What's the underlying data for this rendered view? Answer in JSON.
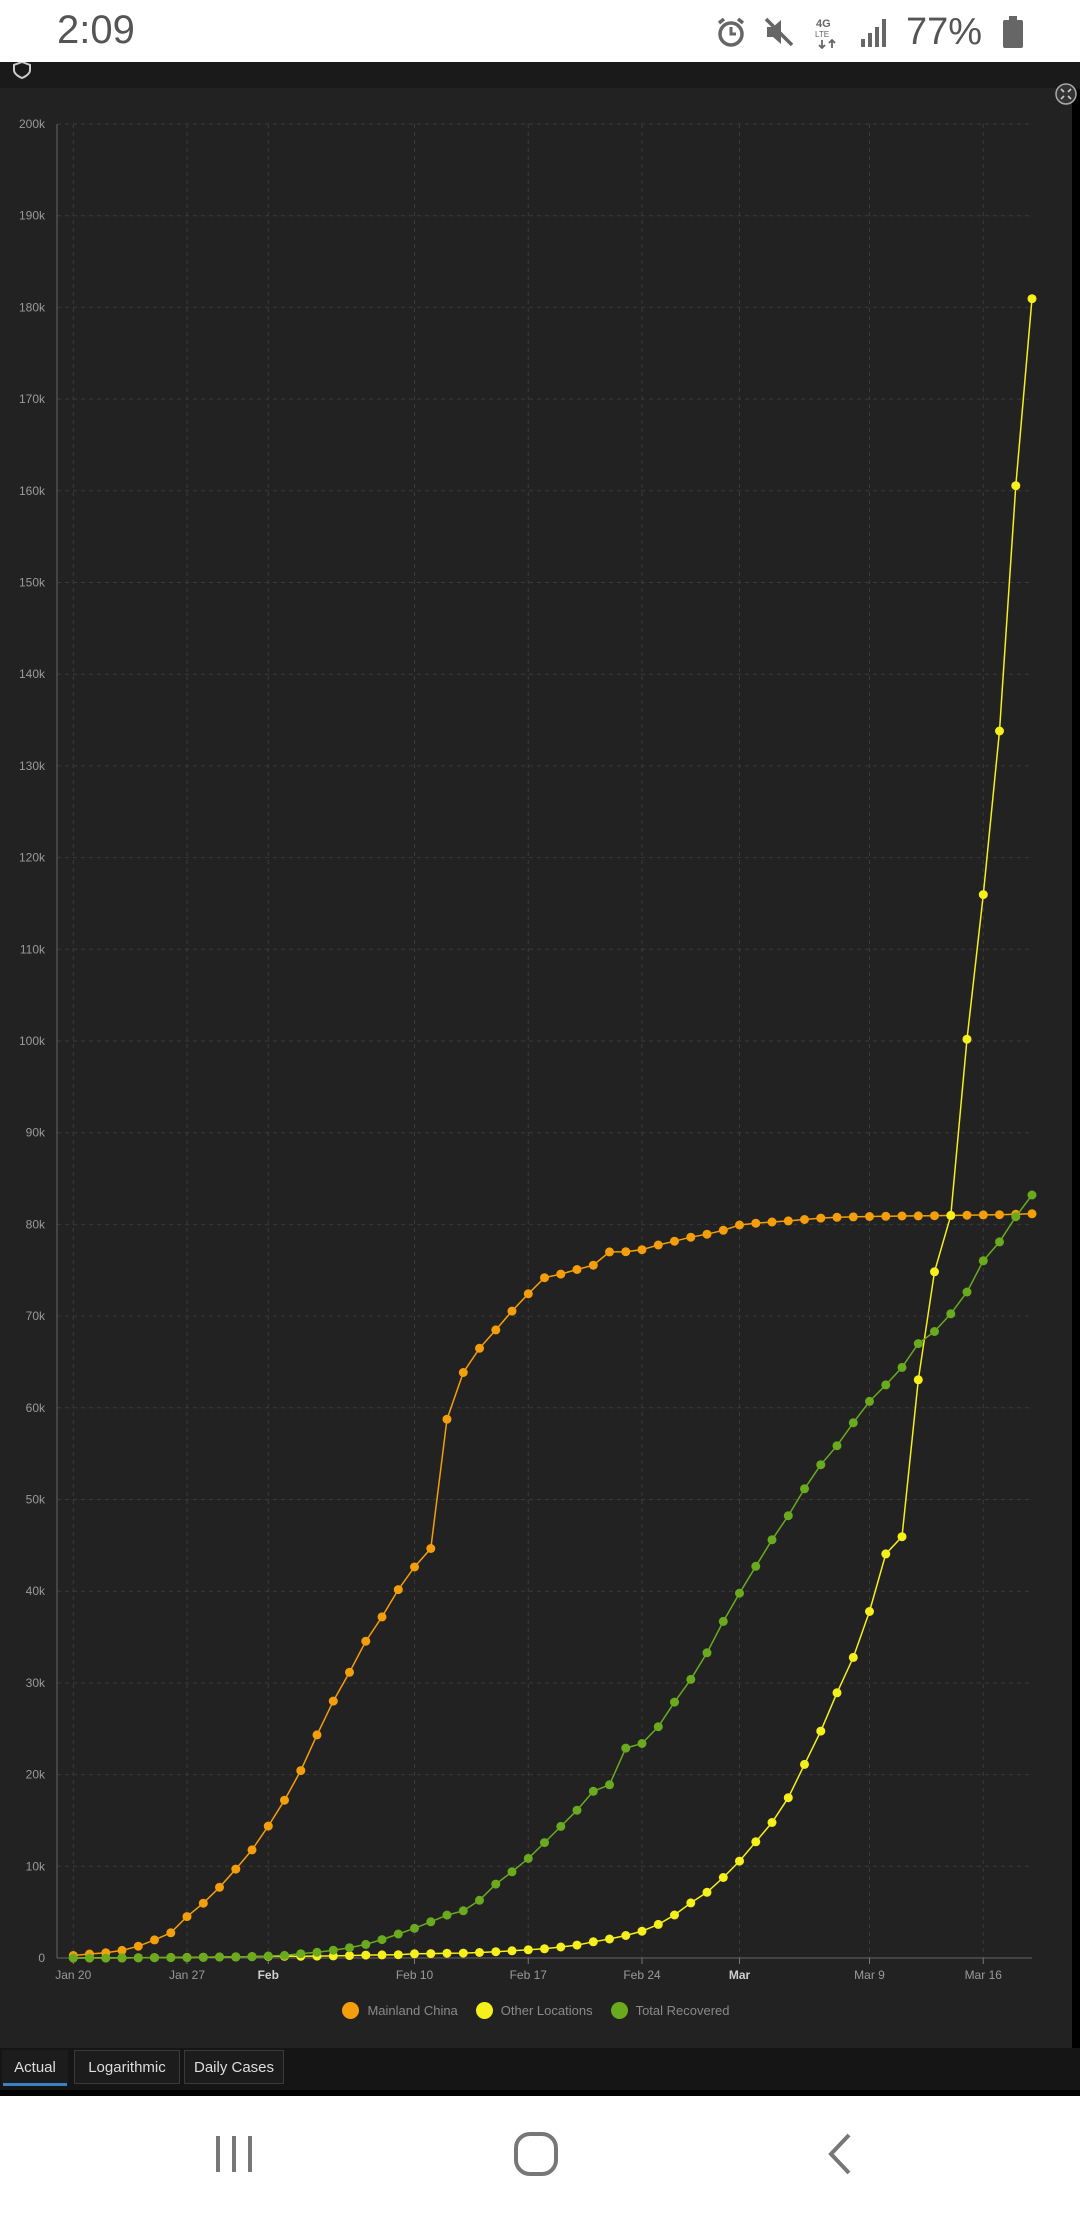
{
  "status_bar": {
    "time": "2:09",
    "battery_percent": "77%",
    "icons": [
      "alarm-icon",
      "mute-icon",
      "4g-lte-icon",
      "signal-icon",
      "battery-icon"
    ]
  },
  "tabs": [
    {
      "label": "Actual",
      "active": true
    },
    {
      "label": "Logarithmic",
      "active": false
    },
    {
      "label": "Daily Cases",
      "active": false
    }
  ],
  "nav_icons": [
    "recent-apps-icon",
    "home-icon",
    "back-icon"
  ],
  "chart_data": {
    "type": "line",
    "title": "",
    "xlabel": "",
    "ylabel": "",
    "ylim": [
      0,
      200000
    ],
    "yticks": [
      0,
      10000,
      20000,
      30000,
      40000,
      50000,
      60000,
      70000,
      80000,
      90000,
      100000,
      110000,
      120000,
      130000,
      140000,
      150000,
      160000,
      170000,
      180000,
      190000,
      200000
    ],
    "ytick_labels": [
      "0",
      "10k",
      "20k",
      "30k",
      "40k",
      "50k",
      "60k",
      "70k",
      "80k",
      "90k",
      "100k",
      "110k",
      "120k",
      "130k",
      "140k",
      "150k",
      "160k",
      "170k",
      "180k",
      "190k",
      "200k"
    ],
    "x_range": [
      "2020-01-19",
      "2020-03-19"
    ],
    "xticks": [
      {
        "date": "2020-01-20",
        "label": "Jan 20",
        "bold": false
      },
      {
        "date": "2020-01-27",
        "label": "Jan 27",
        "bold": false
      },
      {
        "date": "2020-02-01",
        "label": "Feb",
        "bold": true
      },
      {
        "date": "2020-02-10",
        "label": "Feb 10",
        "bold": false
      },
      {
        "date": "2020-02-17",
        "label": "Feb 17",
        "bold": false
      },
      {
        "date": "2020-02-24",
        "label": "Feb 24",
        "bold": false
      },
      {
        "date": "2020-03-01",
        "label": "Mar",
        "bold": true
      },
      {
        "date": "2020-03-09",
        "label": "Mar 9",
        "bold": false
      },
      {
        "date": "2020-03-16",
        "label": "Mar 16",
        "bold": false
      }
    ],
    "grid": true,
    "legend_position": "bottom-center",
    "start_date": "2020-01-20",
    "series": [
      {
        "name": "Mainland China",
        "color": "#f59e0b",
        "values": [
          278,
          440,
          571,
          830,
          1287,
          1975,
          2744,
          4515,
          5974,
          7711,
          9692,
          11791,
          14380,
          17205,
          20438,
          24324,
          28018,
          31161,
          34546,
          37198,
          40171,
          42638,
          44653,
          58761,
          63851,
          66492,
          68500,
          70548,
          72436,
          74185,
          74576,
          75077,
          75550,
          77001,
          77022,
          77241,
          77754,
          78166,
          78600,
          78928,
          79356,
          79932,
          80136,
          80261,
          80386,
          80537,
          80690,
          80770,
          80823,
          80860,
          80887,
          80921,
          80932,
          80945,
          80977,
          81003,
          81033,
          81058,
          81102,
          81156
        ]
      },
      {
        "name": "Other Locations",
        "color": "#f5ef1b",
        "values": [
          4,
          6,
          8,
          14,
          25,
          40,
          57,
          64,
          87,
          105,
          118,
          153,
          173,
          183,
          188,
          212,
          227,
          265,
          317,
          343,
          361,
          457,
          476,
          523,
          538,
          595,
          685,
          780,
          896,
          999,
          1200,
          1402,
          1769,
          2069,
          2459,
          2918,
          3664,
          4691,
          6009,
          7169,
          8774,
          10566,
          12668,
          14778,
          17481,
          21110,
          24747,
          28924,
          32776,
          37788,
          44067,
          45944,
          63049,
          74826,
          80982,
          100200,
          115963,
          133811,
          160558,
          180954
        ]
      },
      {
        "name": "Total Recovered",
        "color": "#6aaa1e",
        "values": [
          0,
          0,
          0,
          28,
          30,
          36,
          39,
          52,
          61,
          107,
          126,
          143,
          222,
          284,
          472,
          623,
          852,
          1124,
          1487,
          2011,
          2616,
          3244,
          3946,
          4683,
          5150,
          6295,
          8058,
          9395,
          10865,
          12583,
          14352,
          16121,
          18177,
          18890,
          22886,
          23394,
          25227,
          27905,
          30384,
          33277,
          36711,
          39782,
          42716,
          45602,
          48228,
          51170,
          53796,
          55865,
          58359,
          60694,
          62494,
          64404,
          67003,
          68324,
          70251,
          72624,
          76034,
          78088,
          80840,
          83207
        ]
      }
    ]
  }
}
